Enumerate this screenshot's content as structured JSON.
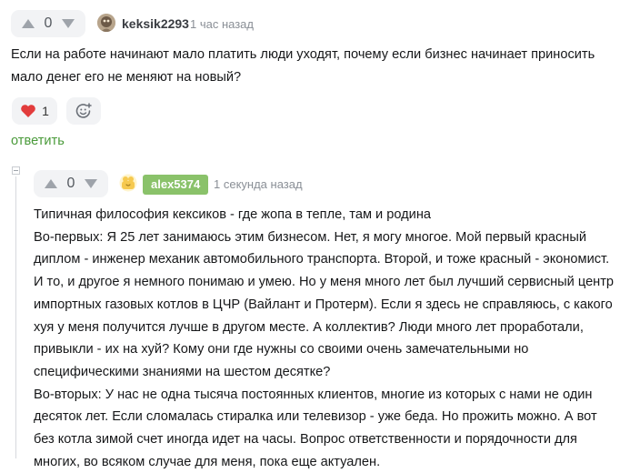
{
  "comment1": {
    "vote_count": "0",
    "author": "keksik2293",
    "time": "1 час назад",
    "text_lines": [
      "Если на работе начинают мало платить люди уходят, почему если бизнес начинает приносить",
      "мало денег его не меняют на новый?"
    ],
    "likes_count": "1",
    "reply_label": "ответить"
  },
  "comment2": {
    "vote_count": "0",
    "author": "alex5374",
    "time": "1 секунда назад",
    "text_lines": [
      "Типичная философия кексиков - где жопа в тепле, там и родина",
      "Во-первых: Я 25 лет занимаюсь этим бизнесом. Нет, я могу многое. Мой первый красный",
      "диплом - инженер механик автомобильного транспорта. Второй, и тоже красный - экономист.",
      "И то, и другое я немного понимаю и умею. Но у меня много лет был лучший сервисный центр",
      "импортных газовых котлов в ЦЧР (Вайлант и Протерм). Если я здесь не справляюсь, с какого",
      "хуя у меня получится лучше в другом месте. А коллектив? Люди много лет проработали,",
      "привыкли - их на хуй? Кому они где нужны со своими очень замечательными но",
      "специфическими знаниями на шестом десятке?",
      "Во-вторых: У нас не одна тысяча постоянных клиентов, многие из которых с нами не один",
      "десяток лет. Если сломалась стиралка или телевизор - уже беда. Но прожить можно. А вот",
      "без котла зимой счет иногда идет на часы. Вопрос ответственности и порядочности для",
      "многих, во всяком случае для меня, пока еще актуален."
    ]
  },
  "colors": {
    "accent_green": "#8ac26a",
    "reply_green": "#4a9a3a",
    "like_red": "#e23c3c",
    "chip_bg": "#f2f3f5"
  },
  "icons": [
    "arrow-up-icon",
    "arrow-down-icon",
    "heart-icon",
    "emoji-add-icon",
    "avatar",
    "collapse-icon"
  ]
}
